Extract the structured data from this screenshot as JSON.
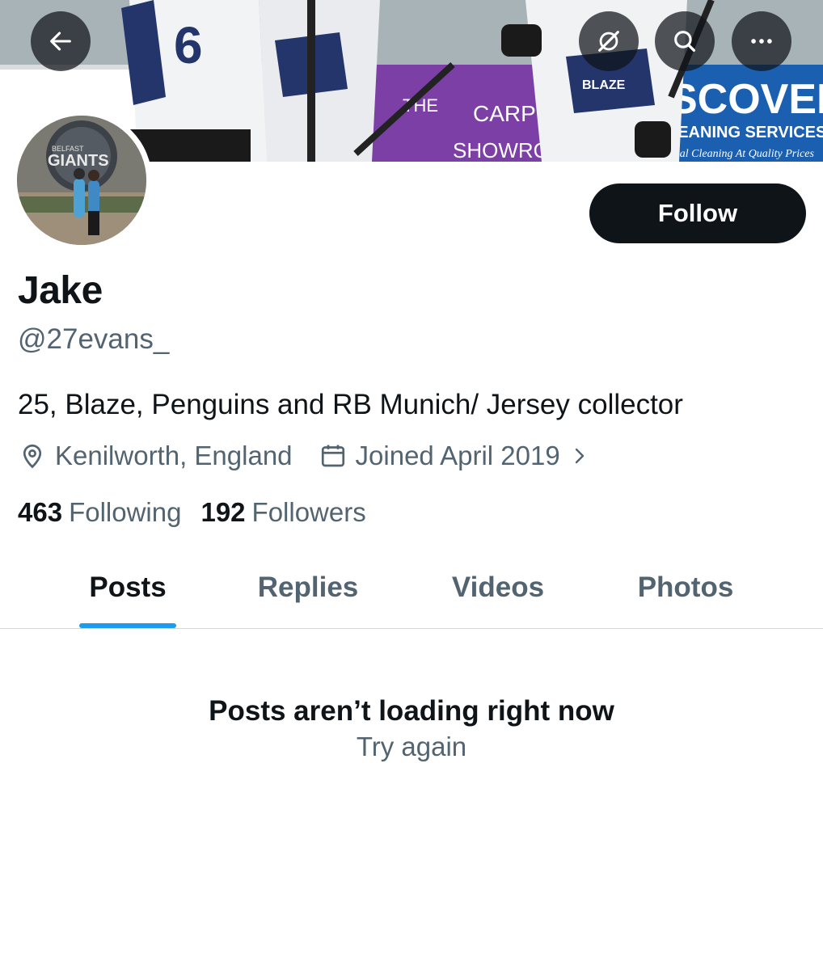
{
  "header": {
    "back_icon": "arrow-left-icon",
    "grok_icon": "grok-icon",
    "search_icon": "search-icon",
    "more_icon": "more-horizontal-icon",
    "banner_text": {
      "shirt_number": "6",
      "sign_1": "THE",
      "sign_2": "CARPET",
      "sign_3": "SHOWROOM",
      "sign_4": "SCOVERY",
      "sign_5": "LEANING SERVICES",
      "sign_6": "ssional Cleaning At Quality Prices",
      "badge": "BLAZE"
    }
  },
  "avatar": {
    "sign_text": "GIANTS",
    "sign_small": "BELFAST"
  },
  "profile": {
    "follow_label": "Follow",
    "display_name": "Jake",
    "handle": "@27evans_",
    "bio": "25, Blaze, Penguins and RB Munich/ Jersey collector",
    "location": "Kenilworth, England",
    "joined": "Joined April 2019",
    "following_count": "463",
    "following_label": "Following",
    "followers_count": "192",
    "followers_label": "Followers"
  },
  "tabs": [
    {
      "label": "Posts",
      "active": true
    },
    {
      "label": "Replies",
      "active": false
    },
    {
      "label": "Videos",
      "active": false
    },
    {
      "label": "Photos",
      "active": false
    }
  ],
  "feed": {
    "empty_title": "Posts aren’t loading right now",
    "retry_label": "Try again"
  },
  "colors": {
    "accent": "#1d9bf0",
    "text_primary": "#0f1419",
    "text_secondary": "#536471",
    "button_dark": "#0f1419"
  }
}
